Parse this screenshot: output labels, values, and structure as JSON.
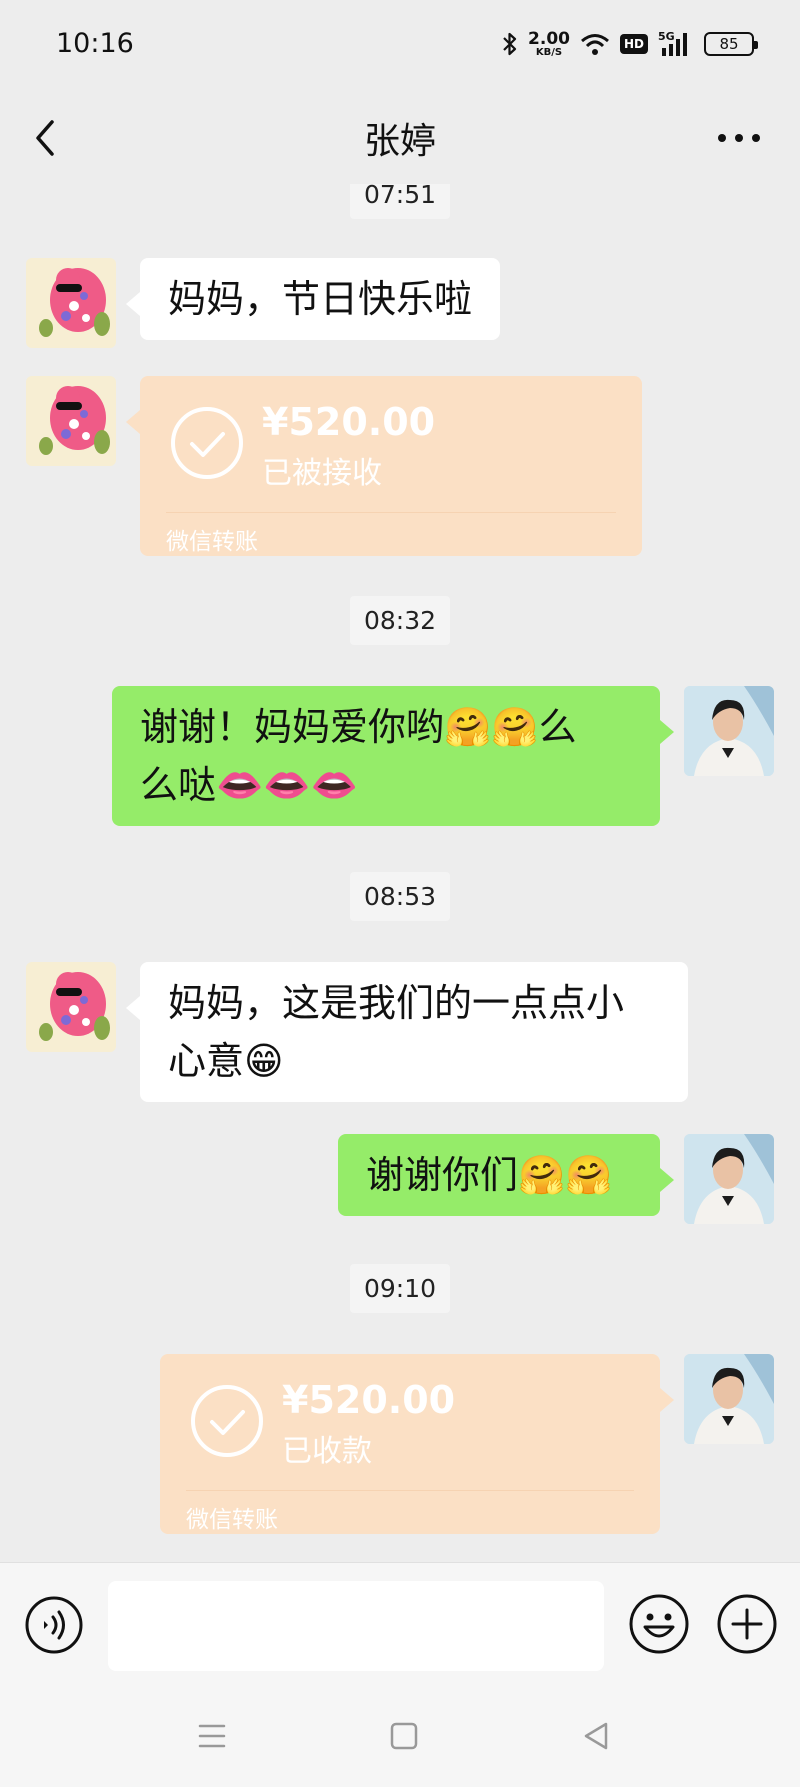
{
  "status_bar": {
    "time": "10:16",
    "net_speed_value": "2.00",
    "net_speed_unit": "KB/S",
    "hd_label": "HD",
    "network_label": "5G",
    "battery": "85"
  },
  "header": {
    "title": "张婷"
  },
  "messages": {
    "ts1": "07:51",
    "m1": "妈妈，节日快乐啦",
    "transfer1": {
      "amount": "¥520.00",
      "status": "已被接收",
      "footer": "微信转账"
    },
    "ts2": "08:32",
    "m2_line1": "谢谢！妈妈爱你哟🤗🤗么",
    "m2_line2": "么哒👄👄👄",
    "ts3": "08:53",
    "m3_line1": "妈妈，这是我们的一点点小",
    "m3_line2": "心意😁",
    "m4": "谢谢你们🤗🤗",
    "ts4": "09:10",
    "transfer2": {
      "amount": "¥520.00",
      "status": "已收款",
      "footer": "微信转账"
    }
  },
  "icons": {
    "back": "chevron-left-icon",
    "more": "more-icon",
    "voice": "voice-icon",
    "emoji": "emoji-icon",
    "plus": "plus-icon"
  },
  "colors": {
    "background": "#ededed",
    "bubble_self": "#95ec69",
    "bubble_other": "#ffffff",
    "transfer_received": "#fbe0c5"
  }
}
